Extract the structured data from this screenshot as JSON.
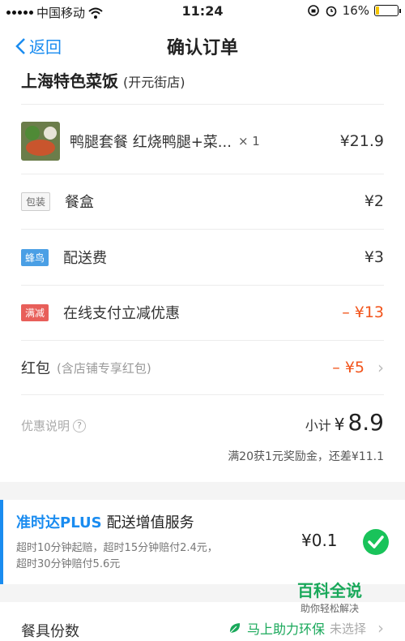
{
  "status_bar": {
    "carrier": "中国移动",
    "time": "11:24",
    "battery_percent": "16%",
    "battery_level": 0.16
  },
  "nav": {
    "back_label": "返回",
    "title": "确认订单"
  },
  "shop": {
    "name": "上海特色菜饭",
    "branch": "(开元街店)"
  },
  "items": [
    {
      "name": "鸭腿套餐 红烧鸭腿+菜...",
      "qty": "× 1",
      "price": "¥21.9"
    }
  ],
  "fees": [
    {
      "tag": "包装",
      "label": "餐盒",
      "price": "¥2"
    },
    {
      "tag": "蜂鸟",
      "label": "配送费",
      "price": "¥3"
    },
    {
      "tag": "满减",
      "label": "在线支付立减优惠",
      "price": "– ¥13"
    }
  ],
  "red_packet": {
    "label": "红包",
    "hint": "(含店铺专享红包)",
    "price": "– ¥5"
  },
  "summary": {
    "discount_note": "优惠说明",
    "subtotal_label": "小计",
    "subtotal_currency": "¥",
    "subtotal_amount": "8.9",
    "reward_text": "满20获1元奖励金，还差¥11.1"
  },
  "plus": {
    "brand": "准时达PLUS",
    "title": "配送增值服务",
    "description": "超时10分钟起赔，超时15分钟赔付2.4元，超时30分钟赔付5.6元",
    "price": "¥0.1"
  },
  "tableware": {
    "label": "餐具份数",
    "eco_text": "马上助力环保",
    "status": "未选择"
  },
  "watermark": {
    "main": "百科全说",
    "sub": "助你轻松解决"
  },
  "colors": {
    "accent_blue": "#1a8cf0",
    "discount_red": "#f2541b",
    "eco_green": "#19a85a",
    "check_green": "#19c35a"
  }
}
